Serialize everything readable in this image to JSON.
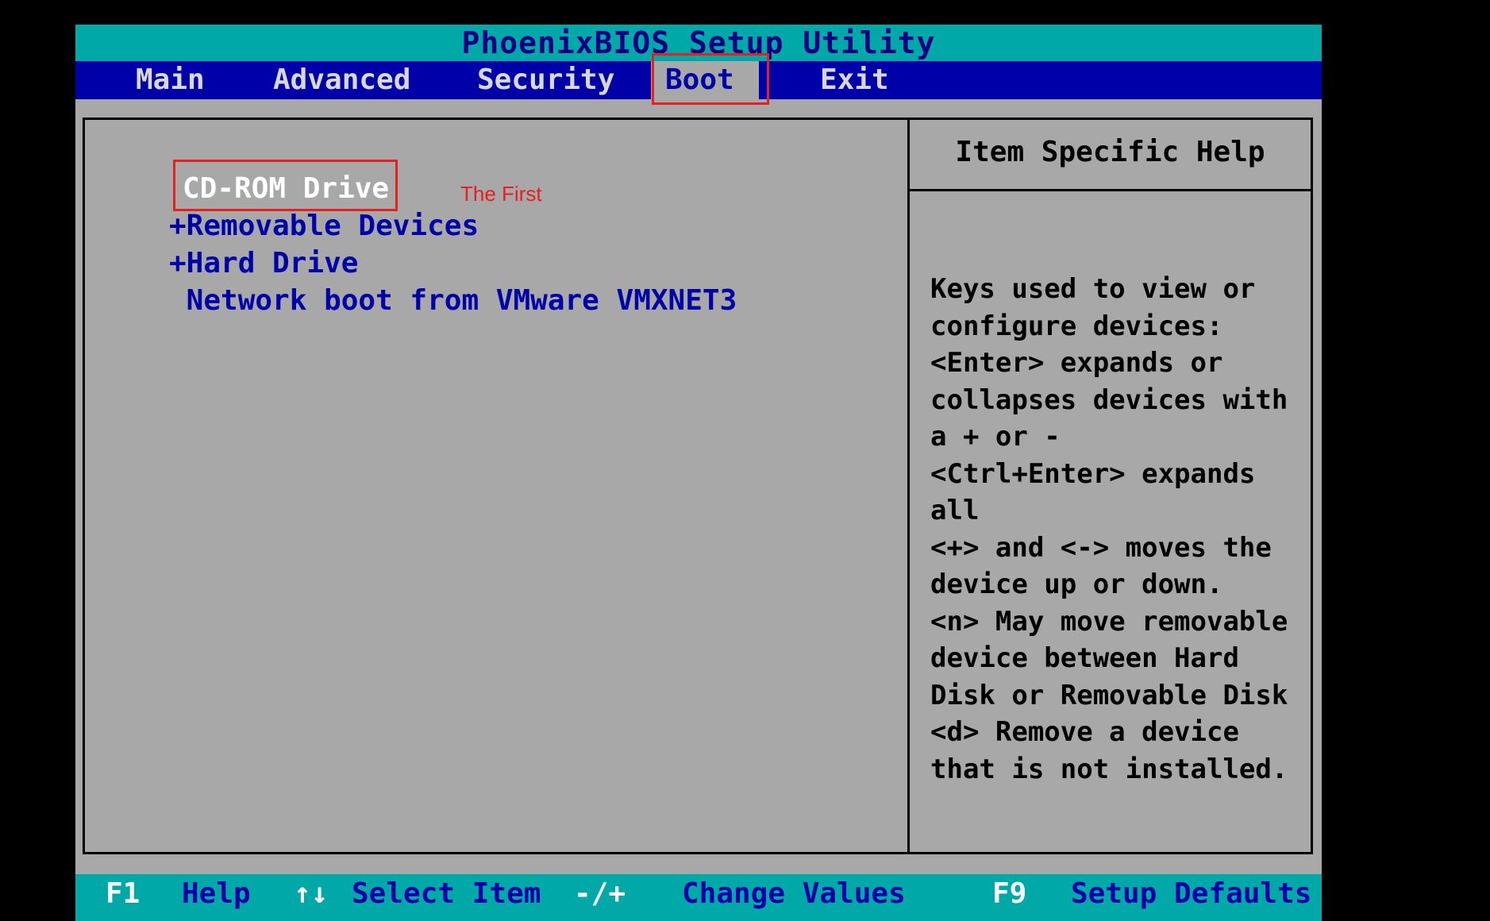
{
  "title": "PhoenixBIOS Setup Utility",
  "menu": {
    "items": [
      {
        "label": "Main",
        "selected": false
      },
      {
        "label": "Advanced",
        "selected": false
      },
      {
        "label": "Security",
        "selected": false
      },
      {
        "label": "Boot",
        "selected": true
      },
      {
        "label": "Exit",
        "selected": false
      }
    ]
  },
  "boot": {
    "items": [
      {
        "label": "CD-ROM Drive",
        "selected": true
      },
      {
        "label": "+Removable Devices",
        "selected": false
      },
      {
        "label": "+Hard Drive",
        "selected": false
      },
      {
        "label": " Network boot from VMware VMXNET3",
        "selected": false
      }
    ]
  },
  "annotation": {
    "label": "The First",
    "color": "#e52020"
  },
  "help": {
    "title": "Item Specific Help",
    "lines": [
      "Keys used to view or",
      "configure devices:",
      "<Enter> expands or",
      "collapses devices with",
      "a + or -",
      "<Ctrl+Enter> expands",
      "all",
      "<+> and <-> moves the",
      "device up or down.",
      "<n> May move removable",
      "device between Hard",
      "Disk or Removable Disk",
      "<d> Remove a device",
      "that is not installed."
    ]
  },
  "status": {
    "row1": [
      {
        "key": "F1",
        "desc": "Help"
      },
      {
        "key": "↑↓",
        "desc": "Select Item"
      },
      {
        "key": "-/+",
        "desc": "Change Values"
      },
      {
        "key": "F9",
        "desc": "Setup Defaults"
      }
    ]
  },
  "colors": {
    "title_bg": "#00a8a8",
    "menu_bg": "#0000a8",
    "body_bg": "#a8a8a8",
    "selected_text": "#ffffff",
    "item_text": "#0000a8"
  }
}
